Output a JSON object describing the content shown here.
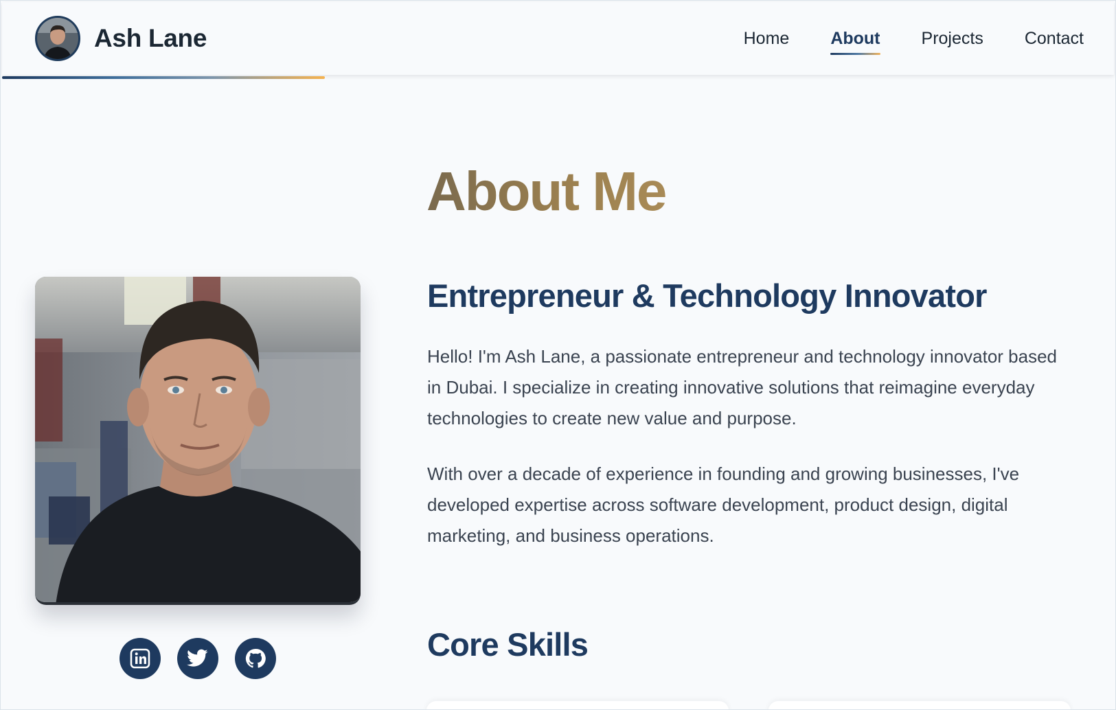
{
  "brand": {
    "name": "Ash Lane",
    "avatar_alt": "Ash Lane avatar"
  },
  "nav": {
    "items": [
      {
        "label": "Home",
        "active": false
      },
      {
        "label": "About",
        "active": true
      },
      {
        "label": "Projects",
        "active": false
      },
      {
        "label": "Contact",
        "active": false
      }
    ]
  },
  "scroll_progress": 0.29,
  "about": {
    "title": "About Me",
    "subtitle": "Entrepreneur & Technology Innovator",
    "paragraphs": [
      "Hello! I'm Ash Lane, a passionate entrepreneur and technology innovator based in Dubai. I specialize in creating innovative solutions that reimagine everyday technologies to create new value and purpose.",
      "With over a decade of experience in founding and growing businesses, I've developed expertise across software development, product design, digital marketing, and business operations."
    ],
    "skills_title": "Core Skills"
  },
  "socials": [
    {
      "name": "linkedin-icon"
    },
    {
      "name": "twitter-icon"
    },
    {
      "name": "github-icon"
    }
  ],
  "colors": {
    "primary": "#1e3a5f",
    "accent": "#f5b24f",
    "title_gold": "#9a7f4f",
    "background": "#f8fafc",
    "text": "#3a4350"
  }
}
